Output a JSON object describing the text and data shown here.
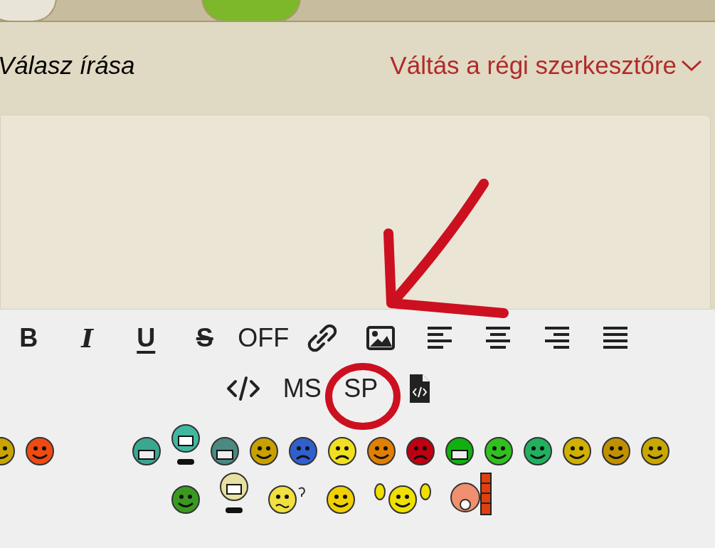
{
  "avatars": [
    {
      "color": "#e8e4d8"
    },
    {
      "color": "#7cb82a"
    }
  ],
  "reply_heading": "Válasz írása",
  "switch_editor_link": "Váltás a régi szerkesztőre",
  "toolbar_row_1": [
    {
      "kind": "bold",
      "label": "B"
    },
    {
      "kind": "italic",
      "label": "I"
    },
    {
      "kind": "underline",
      "label": "U"
    },
    {
      "kind": "strike",
      "label": "S"
    },
    {
      "kind": "text",
      "label": "OFF"
    },
    {
      "kind": "link"
    },
    {
      "kind": "image"
    },
    {
      "kind": "align-left"
    },
    {
      "kind": "align-center"
    },
    {
      "kind": "align-right"
    },
    {
      "kind": "justify"
    }
  ],
  "toolbar_row_2": [
    {
      "kind": "code"
    },
    {
      "kind": "text",
      "label": "MS"
    },
    {
      "kind": "text",
      "label": "SP"
    },
    {
      "kind": "file-code"
    }
  ],
  "smileys_row_1_left": [
    {
      "kind": "face",
      "color": "#c9a400"
    },
    {
      "kind": "face",
      "color": "#f04a10"
    }
  ],
  "smileys_row_1_right": [
    {
      "kind": "grin",
      "color": "#3aa890"
    },
    {
      "kind": "tall",
      "color": "#40b8a0"
    },
    {
      "kind": "grin",
      "color": "#4a8a80"
    },
    {
      "kind": "face",
      "color": "#c8a000"
    },
    {
      "kind": "sad",
      "color": "#3060d0"
    },
    {
      "kind": "sad",
      "color": "#f0e020"
    },
    {
      "kind": "face",
      "color": "#e08000"
    },
    {
      "kind": "sad",
      "color": "#c00010"
    },
    {
      "kind": "grin",
      "color": "#10b010"
    },
    {
      "kind": "face",
      "color": "#30c020"
    },
    {
      "kind": "face",
      "color": "#20b060"
    },
    {
      "kind": "face",
      "color": "#d0b000"
    },
    {
      "kind": "face",
      "color": "#c09000"
    },
    {
      "kind": "face",
      "color": "#c8a800"
    }
  ],
  "smileys_row_2": [
    {
      "kind": "face",
      "color": "#3a9a20"
    },
    {
      "kind": "tall",
      "color": "#e8e0a0"
    },
    {
      "kind": "question",
      "color": "#f0e040"
    },
    {
      "kind": "face",
      "color": "#f0d000"
    },
    {
      "kind": "arms",
      "color": "#f0e000"
    },
    {
      "kind": "wall",
      "color": "#f09070"
    }
  ]
}
